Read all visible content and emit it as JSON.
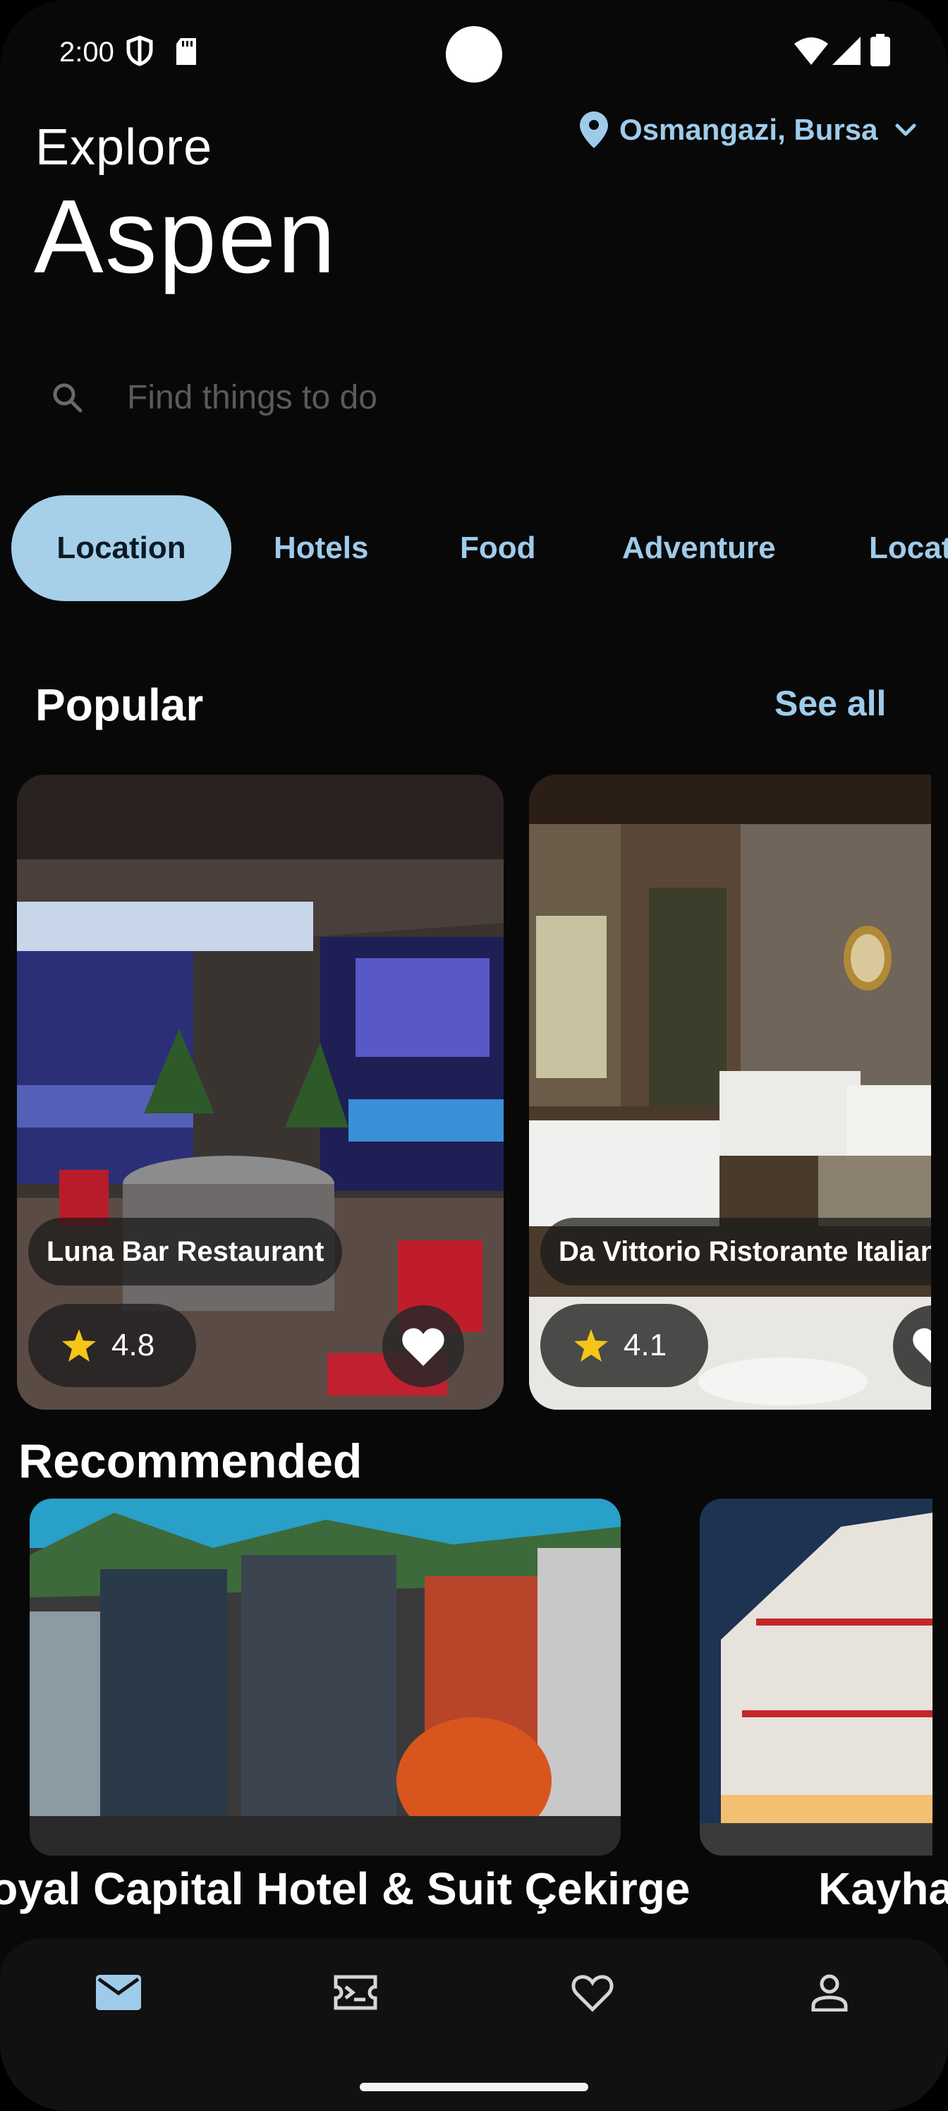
{
  "status_bar": {
    "time": "2:00"
  },
  "header": {
    "explore_label": "Explore",
    "city": "Aspen",
    "location": "Osmangazi, Bursa"
  },
  "search": {
    "placeholder": "Find things to do"
  },
  "tabs": [
    {
      "label": "Location",
      "active": true
    },
    {
      "label": "Hotels",
      "active": false
    },
    {
      "label": "Food",
      "active": false
    },
    {
      "label": "Adventure",
      "active": false
    },
    {
      "label": "Location",
      "active": false
    }
  ],
  "popular": {
    "title": "Popular",
    "see_all": "See all",
    "items": [
      {
        "name": "Luna Bar Restaurant",
        "rating": "4.8",
        "favorite": true
      },
      {
        "name": "Da Vittorio Ristorante Italiano",
        "rating": "4.1",
        "favorite": true
      }
    ]
  },
  "recommended": {
    "title": "Recommended",
    "items": [
      {
        "name": "Royal Capital Hotel & Suit Çekirge"
      },
      {
        "name": "Kayhan Otel"
      }
    ]
  },
  "bottom_nav": [
    {
      "icon": "mail-icon",
      "active": true
    },
    {
      "icon": "ticket-icon",
      "active": false
    },
    {
      "icon": "heart-icon",
      "active": false
    },
    {
      "icon": "profile-icon",
      "active": false
    }
  ],
  "colors": {
    "accent": "#9fcbea",
    "active_tab_bg": "#a6cfe9",
    "star": "#f5c518",
    "background": "#080808"
  }
}
